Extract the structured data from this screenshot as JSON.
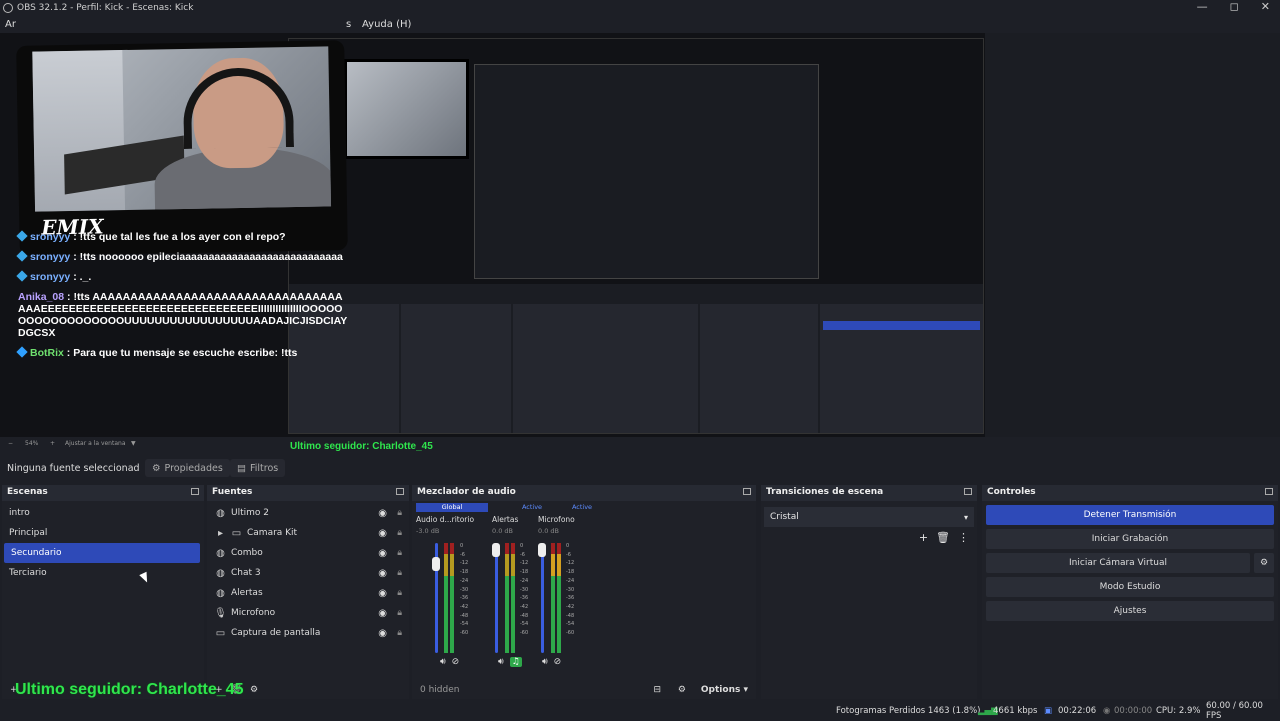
{
  "window": {
    "title": "OBS 32.1.2 - Perfil: Kick - Escenas: Kick",
    "controls": [
      "—",
      "◻",
      "✕"
    ]
  },
  "menu": {
    "first_visible": "Ar",
    "partial": "s",
    "help": "Ayuda (H)"
  },
  "overlay": {
    "logo": "EMIX",
    "chat": [
      {
        "user": "sronyyy",
        "sep": " : ",
        "message": "!tts que tal les fue a los ayer con el repo?"
      },
      {
        "user": "sronyyy",
        "sep": " : ",
        "message": "!tts noooooo epileciaaaaaaaaaaaaaaaaaaaaaaaaaaaa"
      },
      {
        "user": "sronyyy",
        "sep": " : ",
        "message": "._."
      },
      {
        "user": "Anika_08",
        "sep": " : ",
        "message": "!tts AAAAAAAAAAAAAAAAAAAAAAAAAAAAAAAAAAAAEEEEEEEEEEEEEEEEEEEEEEEEEEEEEEEIIIIIIIIIIIIIIIOOOOOOOOOOOOOOOOOOUUUUUUUUUUUUUUUUUAADAJICJISDCIAYDGCSX"
      },
      {
        "user": "BotRix",
        "sep": " : ",
        "message": "Para que tu mensaje se escuche escribe: !tts"
      }
    ],
    "seguidor": "Ultimo seguidor: Charlotte_45",
    "mini_seguidor": "Ultimo seguidor: Charlotte_45"
  },
  "zoom": {
    "minus": "−",
    "value": "54%",
    "plus": "+",
    "fit": "Ajustar a la ventana",
    "caret": "▼"
  },
  "props_bar": {
    "no_source": "Ninguna fuente seleccionad",
    "properties": "Propiedades",
    "filters": "Filtros"
  },
  "scenes": {
    "title": "Escenas",
    "items": [
      "intro",
      "Principal",
      "Secundario",
      "Terciario"
    ],
    "selected_index": 2
  },
  "sources": {
    "title": "Fuentes",
    "items": [
      {
        "name": "Ultimo 2",
        "icon": "globe-icon"
      },
      {
        "name": "Camara Kit",
        "icon": "folder-icon"
      },
      {
        "name": "Combo",
        "icon": "globe-icon"
      },
      {
        "name": "Chat 3",
        "icon": "globe-icon"
      },
      {
        "name": "Alertas",
        "icon": "globe-icon"
      },
      {
        "name": "Microfono",
        "icon": "mic-icon"
      },
      {
        "name": "Captura de pantalla",
        "icon": "monitor-icon"
      }
    ]
  },
  "mixer": {
    "title": "Mezclador de audio",
    "tabs": [
      "Global",
      "Active",
      "Active"
    ],
    "channels": [
      {
        "name": "Audio d...ritorio",
        "db": "-3.0 dB",
        "level": 0.83
      },
      {
        "name": "Alertas",
        "db": "0.0 dB",
        "level": 0.9
      },
      {
        "name": "Microfono",
        "db": "0.0 dB",
        "level": 0.9
      }
    ],
    "scale": [
      "0",
      "-6",
      "-12",
      "-18",
      "-24",
      "-30",
      "-36",
      "-42",
      "-48",
      "-54",
      "-60"
    ],
    "hidden": "0 hidden",
    "options": "Options"
  },
  "transitions": {
    "title": "Transiciones de escena",
    "selected": "Cristal"
  },
  "controls": {
    "title": "Controles",
    "stop_stream": "Detener Transmisión",
    "start_record": "Iniciar Grabación",
    "virtual_cam": "Iniciar Cámara Virtual",
    "studio": "Modo Estudio",
    "settings": "Ajustes"
  },
  "status": {
    "dropped": "Fotogramas Perdidos 1463 (1.8%)",
    "bitrate": "4661 kbps",
    "stream_time": "00:22:06",
    "rec_time": "00:00:00",
    "cpu": "CPU: 2.9%",
    "fps": "60.00 / 60.00 FPS"
  },
  "colors": {
    "accent": "#2e4ab8",
    "green": "#2fe64d",
    "bg": "#1d1f26"
  }
}
